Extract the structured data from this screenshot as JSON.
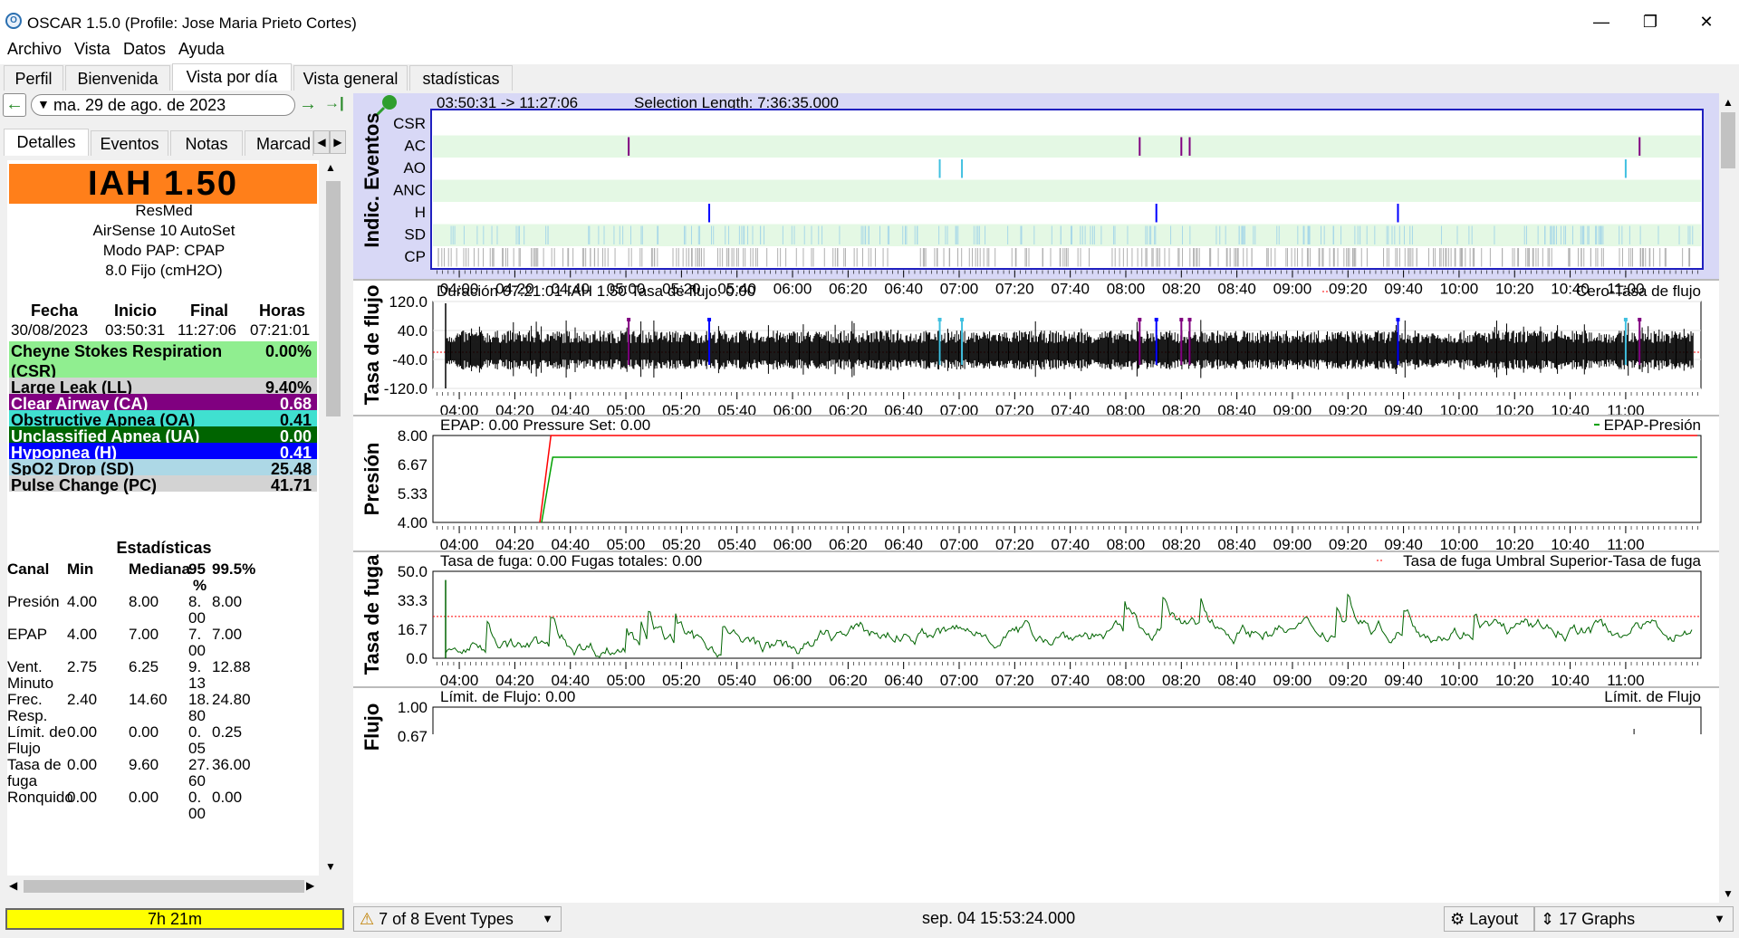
{
  "window": {
    "title": "OSCAR 1.5.0 (Profile: Jose Maria Prieto Cortes)",
    "minimize": "—",
    "maximize": "❐",
    "close": "✕"
  },
  "menu": [
    "Archivo",
    "Vista",
    "Datos",
    "Ayuda"
  ],
  "tabs": [
    "Perfil",
    "Bienvenida",
    "Vista por día",
    "Vista general",
    "stadísticas"
  ],
  "date": {
    "value": "ma. 29 de ago. de 2023",
    "prev": "←",
    "next": "→",
    "last": "→|"
  },
  "subtabs": [
    "Detalles",
    "Eventos",
    "Notas",
    "Marcad"
  ],
  "summary": {
    "iah": "IAH  1.50",
    "device": [
      "ResMed",
      "AirSense 10 AutoSet",
      "Modo PAP: CPAP",
      "8.0 Fijo (cmH2O)"
    ],
    "headers": [
      "Fecha",
      "Inicio",
      "Final",
      "Horas"
    ],
    "values": [
      "30/08/2023",
      "03:50:31",
      "11:27:06",
      "07:21:01"
    ]
  },
  "events": [
    {
      "label": "Cheyne Stokes Respiration",
      "label2": "(CSR)",
      "value": "0.00%",
      "bg": "#90ee90",
      "fg": "#000000"
    },
    {
      "label": "Large Leak (LL)",
      "value": "9.40%",
      "bg": "#d3d3d3",
      "fg": "#000000"
    },
    {
      "label": "Clear Airway (CA)",
      "value": "0.68",
      "bg": "#800080",
      "fg": "#ffffff"
    },
    {
      "label": "Obstructive Apnea (OA)",
      "value": "0.41",
      "bg": "#40e0d0",
      "fg": "#000000"
    },
    {
      "label": "Unclassified Apnea (UA)",
      "value": "0.00",
      "bg": "#006400",
      "fg": "#ffffff"
    },
    {
      "label": "Hypopnea (H)",
      "value": "0.41",
      "bg": "#0000ff",
      "fg": "#ffffff"
    },
    {
      "label": "SpO2 Drop (SD)",
      "value": "25.48",
      "bg": "#add8e6",
      "fg": "#000000"
    },
    {
      "label": "Pulse Change (PC)",
      "value": "41.71",
      "bg": "#d3d3d3",
      "fg": "#000000"
    }
  ],
  "stats": {
    "title": "Estadísticas",
    "headers": [
      "Canal",
      "Min",
      "Mediana",
      "95",
      "%",
      "99.5%"
    ],
    "rows": [
      {
        "c1": "Presión",
        "c2": "",
        "min": "4.00",
        "med": "8.00",
        "p95a": "8.",
        "p95b": "00",
        "p99": "8.00"
      },
      {
        "c1": "EPAP",
        "c2": "",
        "min": "4.00",
        "med": "7.00",
        "p95a": "7.",
        "p95b": "00",
        "p99": "7.00"
      },
      {
        "c1": "Vent.",
        "c2": "Minuto",
        "min": "2.75",
        "med": "6.25",
        "p95a": "9.",
        "p95b": "13",
        "p99": "12.88"
      },
      {
        "c1": "Frec.",
        "c2": "Resp.",
        "min": "2.40",
        "med": "14.60",
        "p95a": "18.",
        "p95b": "80",
        "p99": "24.80"
      },
      {
        "c1": "Límit. de",
        "c2": "Flujo",
        "min": "0.00",
        "med": "0.00",
        "p95a": "0.",
        "p95b": "05",
        "p99": "0.25"
      },
      {
        "c1": "Tasa de",
        "c2": "fuga",
        "min": "0.00",
        "med": "9.60",
        "p95a": "27.",
        "p95b": "60",
        "p99": "36.00"
      },
      {
        "c1": "Ronquido",
        "c2": "",
        "min": "0.00",
        "med": "0.00",
        "p95a": "0.",
        "p95b": "00",
        "p99": "0.00"
      }
    ]
  },
  "footer": {
    "duration": "7h 21m",
    "event_types": "7 of 8 Event Types",
    "timestamp": "sep. 04 15:53:24.000",
    "layout": "Layout",
    "graphs": "17 Graphs"
  },
  "xticks": [
    "04:00",
    "04:20",
    "04:40",
    "05:00",
    "05:20",
    "05:40",
    "06:00",
    "06:20",
    "06:40",
    "07:00",
    "07:20",
    "07:40",
    "08:00",
    "08:20",
    "08:40",
    "09:00",
    "09:20",
    "09:40",
    "10:00",
    "10:20",
    "10:40",
    "11:00"
  ],
  "graphs": {
    "events": {
      "ylabel": "Indic. Eventos",
      "header": "03:50:31 -> 11:27:06",
      "selection": "Selection Length: 7:36:35.000",
      "rows": [
        "CSR",
        "AC",
        "AO",
        "ANC",
        "H",
        "SD",
        "CP"
      ],
      "ac": [
        "05:01",
        "08:05",
        "08:20",
        "08:23",
        "11:05"
      ],
      "ao": [
        "06:53",
        "07:01",
        "11:00"
      ],
      "h": [
        "05:30",
        "08:11",
        "09:38"
      ]
    },
    "flow": {
      "ylabel": "Tasa de flujo",
      "title": "Duración 07:21:01 IAH 1.50 Tasa de flujo: 0.00",
      "legend": "Cero-Tasa de flujo",
      "yticks": [
        "120.0",
        "40.0",
        "-40.0",
        "-120.0"
      ]
    },
    "pressure": {
      "ylabel": "Presión",
      "title": "EPAP: 0.00 Pressure Set: 0.00",
      "legend": "EPAP-Presión",
      "yticks": [
        "8.00",
        "6.67",
        "5.33",
        "4.00"
      ],
      "pressure": 8.0,
      "epap": 7.0
    },
    "leak": {
      "ylabel": "Tasa de fuga",
      "title": "Tasa de fuga: 0.00 Fugas totales: 0.00",
      "legend": "Tasa de fuga Umbral Superior-Tasa de fuga",
      "yticks": [
        "50.0",
        "33.3",
        "16.7",
        "0.0"
      ],
      "threshold": 24
    },
    "flowlim": {
      "ylabel": "Flujo",
      "title": "Límit. de Flujo: 0.00",
      "legend": "Límit. de Flujo",
      "yticks": [
        "1.00",
        "0.67"
      ]
    }
  },
  "colors": {
    "accent": "#ff7f1a",
    "epap": "#00a000",
    "pressure": "#ff0000",
    "leak": "#006400",
    "footer_bar": "#ffff00"
  }
}
